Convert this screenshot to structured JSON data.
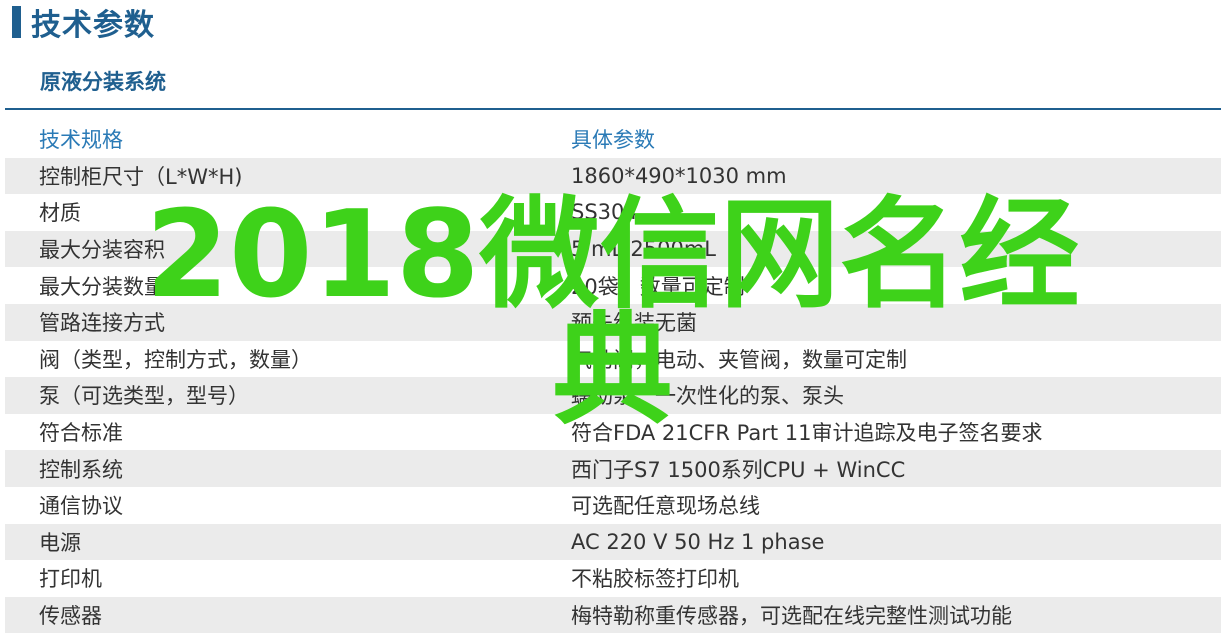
{
  "header": {
    "title": "技术参数"
  },
  "section": {
    "title": "原液分装系统"
  },
  "table": {
    "columns": [
      "技术规格",
      "具体参数"
    ],
    "rows": [
      [
        "控制柜尺寸（L*W*H)",
        "1860*490*1030 mm"
      ],
      [
        "材质",
        "SS304"
      ],
      [
        "最大分装容积",
        "5 mL-2500mL"
      ],
      [
        "最大分装数量",
        "20袋，数量可定制"
      ],
      [
        "管路连接方式",
        "预先组装无菌"
      ],
      [
        "阀（类型，控制方式，数量）",
        "气动阀，电动、夹管阀，数量可定制"
      ],
      [
        "泵（可选类型，型号）",
        "蠕动泵，一次性化的泵、泵头"
      ],
      [
        "符合标准",
        "符合FDA 21CFR Part 11审计追踪及电子签名要求"
      ],
      [
        "控制系统",
        "西门子S7 1500系列CPU + WinCC"
      ],
      [
        "通信协议",
        "可选配任意现场总线"
      ],
      [
        "电源",
        "AC 220 V 50 Hz 1 phase"
      ],
      [
        "打印机",
        "不粘胶标签打印机"
      ],
      [
        "传感器",
        "梅特勒称重传感器，可选配在线完整性测试功能"
      ]
    ]
  },
  "overlay": {
    "line1": "2018微信网名经",
    "line2": "典"
  }
}
